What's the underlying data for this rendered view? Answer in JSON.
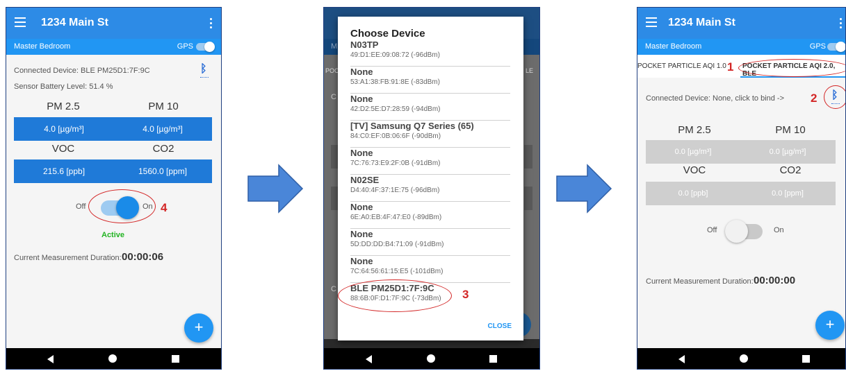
{
  "app": {
    "title": "1234 Main St",
    "room": "Master Bedroom",
    "gps_label": "GPS"
  },
  "colors": {
    "appbar": "#2d8be6",
    "accent": "#2196f3",
    "annotation": "#d32626"
  },
  "screen1": {
    "connected": "Connected Device:  BLE PM25D1:7F:9C",
    "battery": "Sensor Battery Level:  51.4 %",
    "labels": {
      "pm25": "PM 2.5",
      "pm10": "PM 10",
      "voc": "VOC",
      "co2": "CO2"
    },
    "values": {
      "pm25": "4.0 [µg/m³]",
      "pm10": "4.0 [µg/m³]",
      "voc": "215.6 [ppb]",
      "co2": "1560.0 [ppm]"
    },
    "toggle_off": "Off",
    "toggle_on": "On",
    "status": "Active",
    "duration_label": "Current Measurement Duration:",
    "duration": "00:00:06",
    "fab": "+"
  },
  "dialog": {
    "title": "Choose Device",
    "devices": [
      {
        "name": "N03TP",
        "addr": "49:D1:EE:09:08:72 (-96dBm)"
      },
      {
        "name": "None",
        "addr": "53:A1:38:FB:91:8E (-83dBm)"
      },
      {
        "name": "None",
        "addr": "42:D2:5E:D7:28:59 (-94dBm)"
      },
      {
        "name": "[TV] Samsung Q7 Series (65)",
        "addr": "84:C0:EF:0B:06:6F (-90dBm)"
      },
      {
        "name": "None",
        "addr": "7C:76:73:E9:2F:0B (-91dBm)"
      },
      {
        "name": "N02SE",
        "addr": "D4:40:4F:37:1E:75 (-96dBm)"
      },
      {
        "name": "None",
        "addr": "6E:A0:EB:4F:47:E0 (-89dBm)"
      },
      {
        "name": "None",
        "addr": "5D:DD:DD:B4:71:09 (-91dBm)"
      },
      {
        "name": "None",
        "addr": "7C:64:56:61:15:E5 (-101dBm)"
      },
      {
        "name": "BLE PM25D1:7F:9C",
        "addr": "88:6B:0F:D1:7F:9C (-73dBm)"
      }
    ],
    "close": "CLOSE",
    "bg_letters": {
      "m": "M",
      "poc": "POC",
      "le": "LE",
      "c": "C"
    }
  },
  "screen3": {
    "tab1": "POCKET PARTICLE AQI 1.0",
    "tab2": "POCKET PARTICLE AQI 2.0, BLE",
    "connected": "Connected Device:  None, click to bind ->",
    "labels": {
      "pm25": "PM 2.5",
      "pm10": "PM 10",
      "voc": "VOC",
      "co2": "CO2"
    },
    "values": {
      "pm25": "0.0 [µg/m³]",
      "pm10": "0.0 [µg/m³]",
      "voc": "0.0 [ppb]",
      "co2": "0.0 [ppm]"
    },
    "toggle_off": "Off",
    "toggle_on": "On",
    "duration_label": "Current Measurement Duration:",
    "duration": "00:00:00",
    "fab": "+"
  },
  "annotations": {
    "a1": "1",
    "a2": "2",
    "a3": "3",
    "a4": "4"
  },
  "icons": {
    "bluetooth": "ᛒ",
    "home": "home-icon",
    "back": "back-icon",
    "recent": "recent-apps-icon"
  }
}
